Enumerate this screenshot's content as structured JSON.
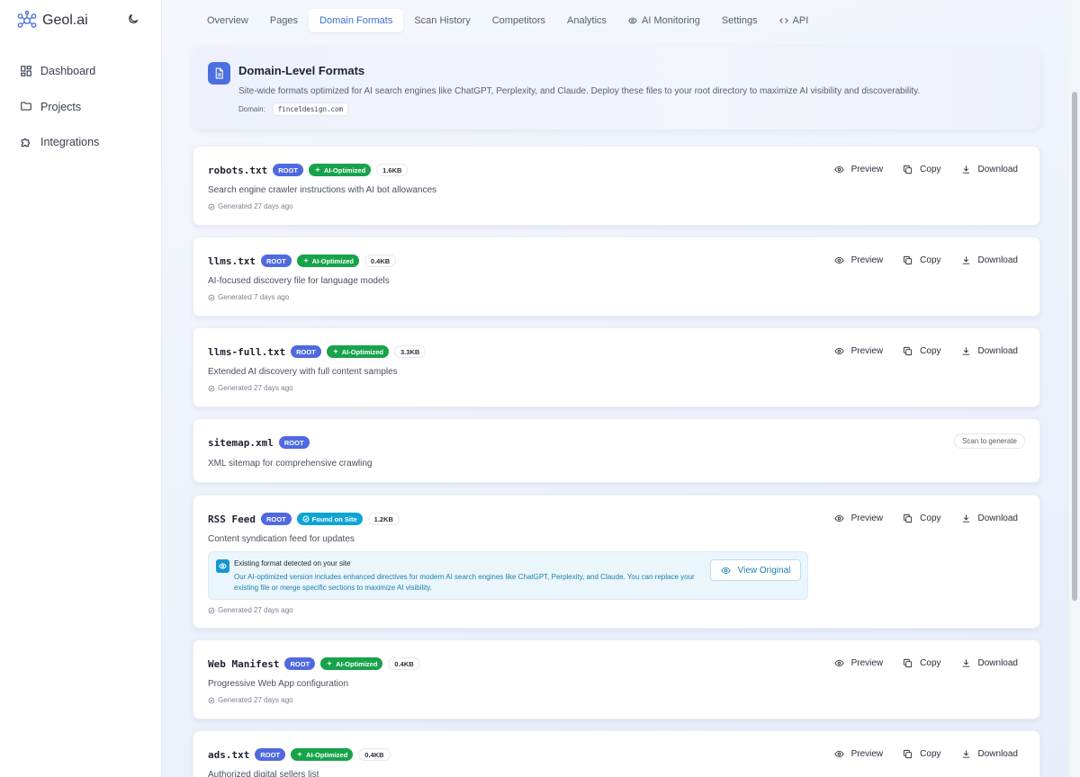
{
  "app": {
    "name_prefix": "Geol",
    "name_suffix": ".ai"
  },
  "sidebar": {
    "items": [
      {
        "label": "Dashboard",
        "icon": "dashboard-icon"
      },
      {
        "label": "Projects",
        "icon": "folder-icon"
      },
      {
        "label": "Integrations",
        "icon": "puzzle-icon"
      }
    ]
  },
  "tabs": [
    {
      "label": "Overview"
    },
    {
      "label": "Pages"
    },
    {
      "label": "Domain Formats",
      "active": true
    },
    {
      "label": "Scan History"
    },
    {
      "label": "Competitors"
    },
    {
      "label": "Analytics"
    },
    {
      "label": "AI Monitoring",
      "icon": "eye-icon"
    },
    {
      "label": "Settings"
    },
    {
      "label": "API",
      "icon": "code-icon"
    }
  ],
  "header": {
    "title": "Domain-Level Formats",
    "subtitle": "Site-wide formats optimized for AI search engines like ChatGPT, Perplexity, and Claude. Deploy these files to your root directory to maximize AI visibility and discoverability.",
    "domain_label": "Domain:",
    "domain_value": "finceldesign.com"
  },
  "actions": {
    "preview": "Preview",
    "copy": "Copy",
    "download": "Download"
  },
  "files": [
    {
      "name": "robots.txt",
      "root": "ROOT",
      "ai": "AI-Optimized",
      "size": "1.6KB",
      "desc": "Search engine crawler instructions with AI bot allowances",
      "generated": "Generated 27 days ago"
    },
    {
      "name": "llms.txt",
      "root": "ROOT",
      "ai": "AI-Optimized",
      "size": "0.4KB",
      "desc": "AI-focused discovery file for language models",
      "generated": "Generated 7 days ago"
    },
    {
      "name": "llms-full.txt",
      "root": "ROOT",
      "ai": "AI-Optimized",
      "size": "3.3KB",
      "desc": "Extended AI discovery with full content samples",
      "generated": "Generated 27 days ago"
    },
    {
      "name": "sitemap.xml",
      "root": "ROOT",
      "desc": "XML sitemap for comprehensive crawling",
      "scan": "Scan to generate"
    },
    {
      "name": "RSS Feed",
      "root": "ROOT",
      "found": "Found on Site",
      "size": "1.2KB",
      "desc": "Content syndication feed for updates",
      "generated": "Generated 27 days ago",
      "notice": {
        "title": "Existing format detected on your site",
        "body": "Our AI-optimized version includes enhanced directives for modern AI search engines like ChatGPT, Perplexity, and Claude. You can replace your existing file or merge specific sections to maximize AI visibility.",
        "button": "View Original"
      }
    },
    {
      "name": "Web Manifest",
      "root": "ROOT",
      "ai": "AI-Optimized",
      "size": "0.4KB",
      "desc": "Progressive Web App configuration",
      "generated": "Generated 27 days ago"
    },
    {
      "name": "ads.txt",
      "root": "ROOT",
      "ai": "AI-Optimized",
      "size": "0.4KB",
      "desc": "Authorized digital sellers list"
    }
  ],
  "colors": {
    "accent": "#3b6fd8",
    "root_badge": "#4f6ae0",
    "ai_badge": "#16a34a",
    "found_badge": "#0ea5d5"
  }
}
